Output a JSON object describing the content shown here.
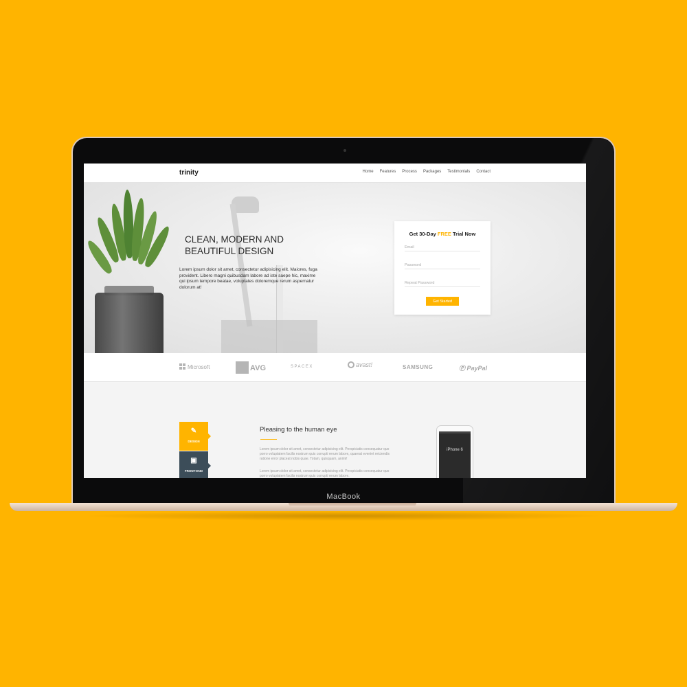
{
  "device": {
    "label": "MacBook"
  },
  "nav": {
    "brand": "trinity",
    "links": [
      "Home",
      "Features",
      "Process",
      "Packages",
      "Testimonials",
      "Contact"
    ]
  },
  "hero": {
    "title_line1": "CLEAN, MODERN AND",
    "title_line2": "BEAUTIFUL DESIGN",
    "text": "Lorem ipsum dolor sit amet, consectetur adipisicing elit. Maiores, fuga provident. Libero magni quibusdam labore ad iste saepe hic, maxime qui ipsum tempore beatae, voluptates doloremque rerum aspernatur dolorum at!"
  },
  "trial": {
    "title_pre": "Get 30-Day ",
    "title_free": "FREE",
    "title_post": " Trial Now",
    "email_placeholder": "Email",
    "password_placeholder": "Password",
    "repeat_password_placeholder": "Repeat Password",
    "button": "Get Started"
  },
  "logos": {
    "microsoft": "Microsoft",
    "avg": "AVG",
    "spacex": "SPACEX",
    "avast": "avast!",
    "samsung": "SAMSUNG",
    "paypal": "PayPal"
  },
  "features": {
    "tabs": [
      {
        "label": "DESIGN",
        "icon": "pencil-icon"
      },
      {
        "label": "FRONT-END",
        "icon": "monitor-icon"
      }
    ],
    "title": "Pleasing to the human eye",
    "paragraph1": "Lorem ipsum dolor sit amet, consectetur adipisicing elit. Perspiciatis consequatur quo porro voluptatem facilis nostrum quis corrupti rerum labore, quaerat eveniet reiciendis ratione error placeat nobis quae. Totam, quisquam, animi!",
    "paragraph2": "Lorem ipsum dolor sit amet, consectetur adipisicing elit. Perspiciatis consequatur quo porro voluptatem facilis nostrum quis corrupti rerum labore.",
    "phone_label": "iPhone 6"
  },
  "colors": {
    "accent": "#FFB400",
    "dark_tab": "#3c4d59",
    "background": "#FFB400"
  }
}
